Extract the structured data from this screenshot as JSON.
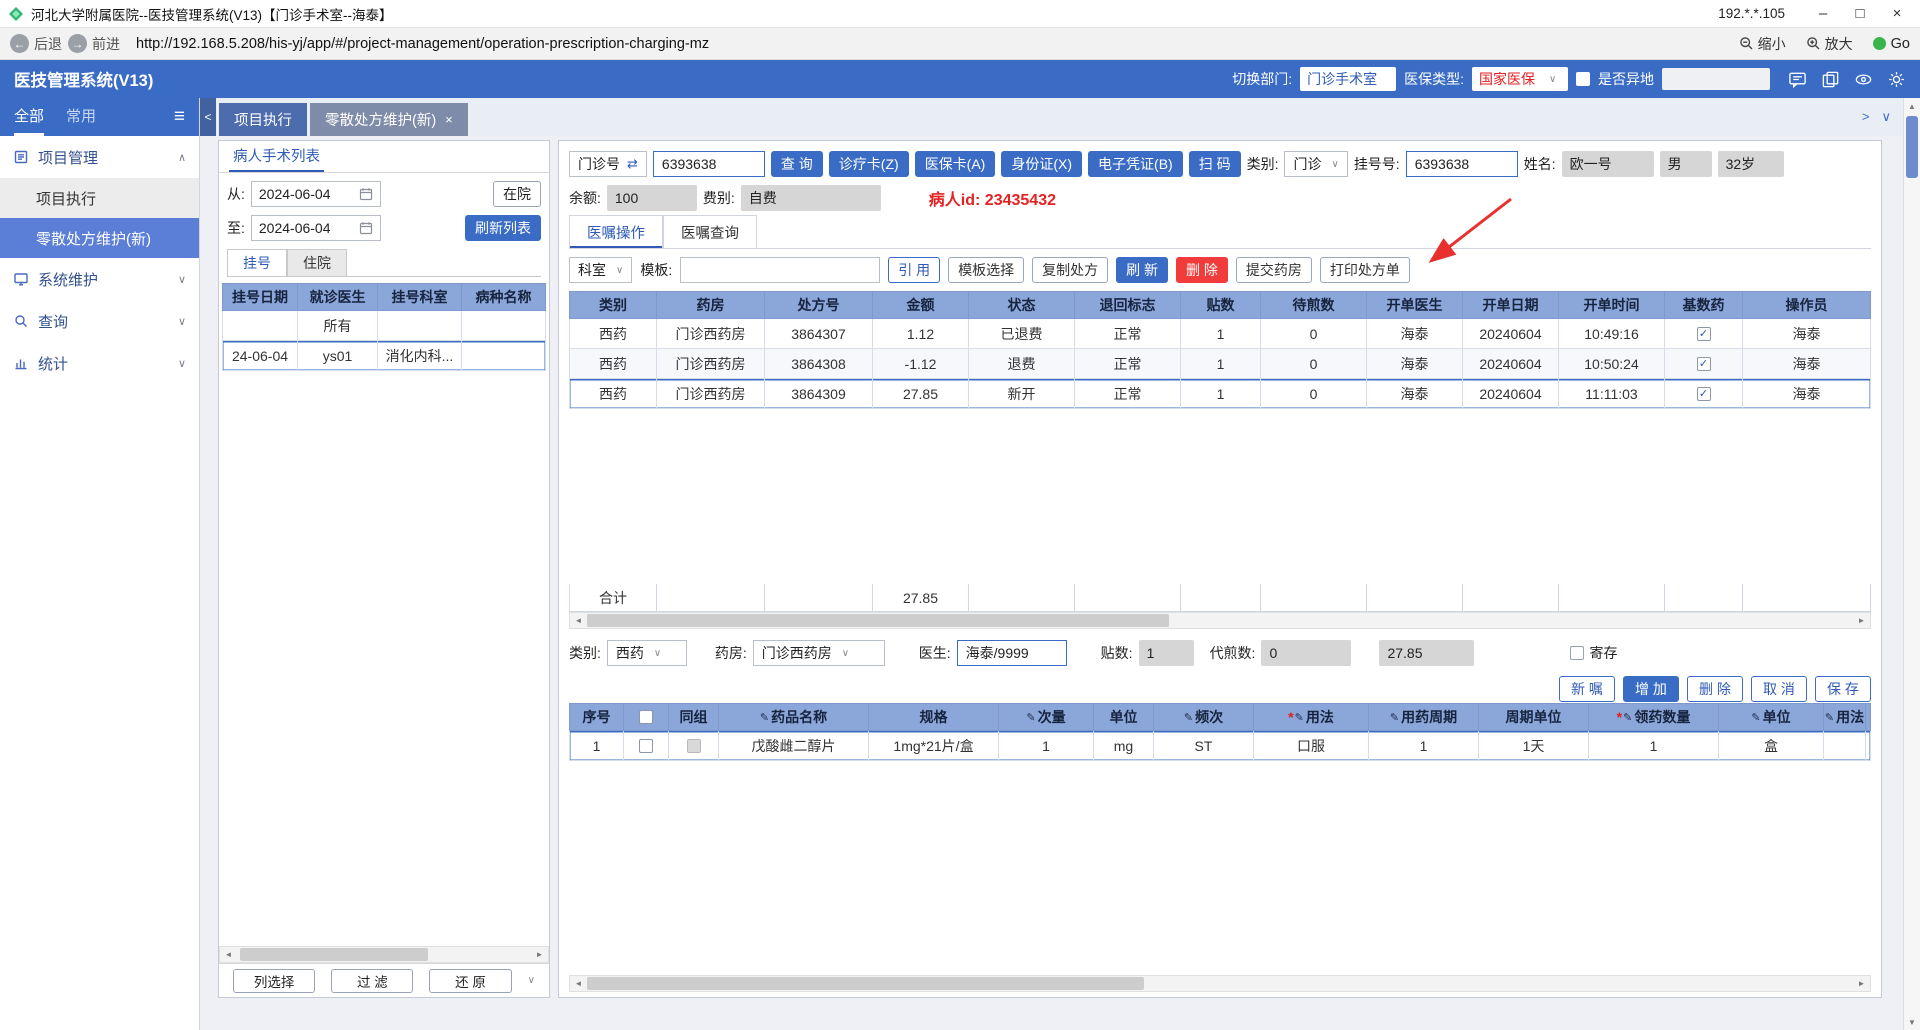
{
  "icons": {
    "minimize": "–",
    "maximize": "□",
    "close": "×",
    "back_arrow": "←",
    "forward_arrow": "→",
    "hamburger": "≡",
    "caret_down": "∨",
    "caret_up": "∧",
    "collapse_left": "<",
    "expand_right": ">",
    "tab_close": "×",
    "swap": "⇄",
    "check": "✓",
    "edit": "✎",
    "required": "*",
    "scroll_left": "◄",
    "scroll_right": "►",
    "scroll_up": "▲",
    "scroll_down": "▼"
  },
  "titlebar": {
    "title": "河北大学附属医院--医技管理系统(V13)【门诊手术室--海泰】",
    "ip": "192.*.*.105"
  },
  "navbar": {
    "back": "后退",
    "forward": "前进",
    "url": "http://192.168.5.208/his-yj/app/#/project-management/operation-prescription-charging-mz",
    "zoom_out": "缩小",
    "zoom_in": "放大",
    "go": "Go"
  },
  "appbar": {
    "title": "医技管理系统(V13)",
    "dept_label": "切换部门:",
    "dept_value": "门诊手术室",
    "insurance_label": "医保类型:",
    "insurance_value": "国家医保",
    "remote_label": "是否异地"
  },
  "sidebar": {
    "tab_all": "全部",
    "tab_common": "常用",
    "group_project": "项目管理",
    "item_exec": "项目执行",
    "item_rx": "零散处方维护(新)",
    "group_system": "系统维护",
    "group_query": "查询",
    "group_stats": "统计"
  },
  "page_tabs": {
    "tab_exec": "项目执行",
    "tab_rx": "零散处方维护(新)"
  },
  "patient_panel": {
    "title": "病人手术列表",
    "from_label": "从:",
    "from_value": "2024-06-04",
    "to_label": "至:",
    "to_value": "2024-06-04",
    "inhospital_btn": "在院",
    "refresh_btn": "刷新列表",
    "tab_outpatient": "挂号",
    "tab_inpatient": "住院",
    "columns": [
      "挂号日期",
      "就诊医生",
      "挂号科室",
      "病种名称"
    ],
    "rows": [
      [
        "",
        "所有",
        "",
        ""
      ],
      [
        "24-06-04",
        "ys01",
        "消化内科...",
        ""
      ]
    ],
    "footer_btns": [
      "列选择",
      "过 滤",
      "还 原"
    ]
  },
  "query": {
    "no_type_label": "门诊号",
    "no_value": "6393638",
    "search_btn": "查 询",
    "card_btns": [
      "诊疗卡(Z)",
      "医保卡(A)",
      "身份证(X)",
      "电子凭证(B)"
    ],
    "scan_btn": "扫 码",
    "type_label": "类别:",
    "type_value": "门诊",
    "regno_label": "挂号号:",
    "regno_value": "6393638",
    "name_label": "姓名:",
    "name_value": "欧一号",
    "sex_value": "男",
    "age_value": "32岁",
    "balance_label": "余额:",
    "balance_value": "100",
    "feetype_label": "费别:",
    "feetype_value": "自费",
    "patient_id_label": "病人id:",
    "patient_id_value": "23435432"
  },
  "order_tabs": {
    "operate": "医嘱操作",
    "query": "医嘱查询"
  },
  "toolbar": {
    "dept_select": "科室",
    "template_label": "模板:",
    "quote_btn": "引 用",
    "template_btn": "模板选择",
    "copy_btn": "复制处方",
    "refresh_btn": "刷 新",
    "delete_btn": "删 除",
    "submit_btn": "提交药房",
    "print_btn": "打印处方单"
  },
  "rx_table": {
    "columns": [
      "类别",
      "药房",
      "处方号",
      "金额",
      "状态",
      "退回标志",
      "贴数",
      "待煎数",
      "开单医生",
      "开单日期",
      "开单时间",
      "基数药",
      "操作员"
    ],
    "rows": [
      [
        "西药",
        "门诊西药房",
        "3864307",
        "1.12",
        "已退费",
        "正常",
        "1",
        "0",
        "海泰",
        "20240604",
        "10:49:16",
        true,
        "海泰"
      ],
      [
        "西药",
        "门诊西药房",
        "3864308",
        "-1.12",
        "退费",
        "正常",
        "1",
        "0",
        "海泰",
        "20240604",
        "10:50:24",
        true,
        "海泰"
      ],
      [
        "西药",
        "门诊西药房",
        "3864309",
        "27.85",
        "新开",
        "正常",
        "1",
        "0",
        "海泰",
        "20240604",
        "11:11:03",
        true,
        "海泰"
      ]
    ],
    "total_rows": [
      [
        "合计",
        "",
        "",
        "27.85",
        "",
        "",
        "",
        "",
        "",
        "",
        "",
        "",
        ""
      ]
    ]
  },
  "detail_form": {
    "type_label": "类别:",
    "type_value": "西药",
    "pharmacy_label": "药房:",
    "pharmacy_value": "门诊西药房",
    "doctor_label": "医生:",
    "doctor_value": "海泰/9999",
    "tie_label": "贴数:",
    "tie_value": "1",
    "decoct_label": "代煎数:",
    "decoct_value": "0",
    "amount_value": "27.85",
    "deposit_label": "寄存",
    "buttons": [
      "新 嘱",
      "增 加",
      "删 除",
      "取 消",
      "保 存"
    ]
  },
  "detail_table": {
    "columns": [
      {
        "label": "序号"
      },
      {
        "label": "",
        "checkbox": true
      },
      {
        "label": "同组"
      },
      {
        "label": "药品名称",
        "edit": true
      },
      {
        "label": "规格"
      },
      {
        "label": "次量",
        "edit": true
      },
      {
        "label": "单位"
      },
      {
        "label": "频次",
        "edit": true
      },
      {
        "label": "用法",
        "edit": true,
        "required": true
      },
      {
        "label": "用药周期",
        "edit": true
      },
      {
        "label": "周期单位"
      },
      {
        "label": "领药数量",
        "edit": true,
        "required": true
      },
      {
        "label": "单位",
        "edit": true
      },
      {
        "label": "用法",
        "edit": true
      },
      {
        "label": ""
      }
    ],
    "rows": [
      [
        "1",
        false,
        false,
        "戊酸雌二醇片",
        "1mg*21片/盒",
        "1",
        "mg",
        "ST",
        "口服",
        "1",
        "1天",
        "1",
        "盒",
        "",
        ""
      ]
    ]
  }
}
